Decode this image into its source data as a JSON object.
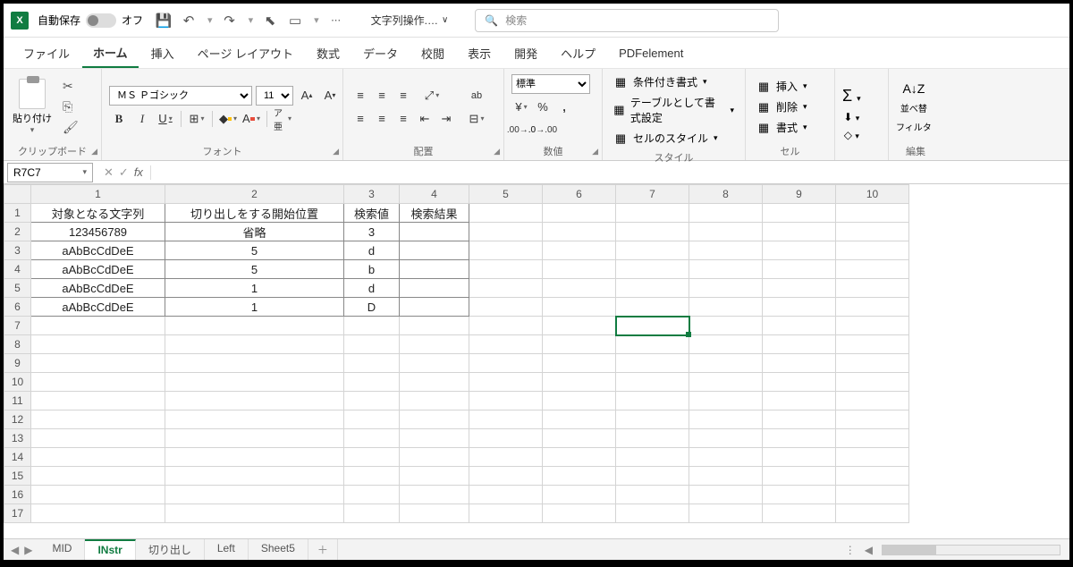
{
  "titlebar": {
    "autosave_label": "自動保存",
    "autosave_state": "オフ",
    "doc_title": "文字列操作.…",
    "search_placeholder": "検索"
  },
  "tabs": {
    "file": "ファイル",
    "home": "ホーム",
    "insert": "挿入",
    "page_layout": "ページ レイアウト",
    "formulas": "数式",
    "data": "データ",
    "review": "校閲",
    "view": "表示",
    "developer": "開発",
    "help": "ヘルプ",
    "pdfelement": "PDFelement"
  },
  "ribbon": {
    "clipboard": {
      "paste": "貼り付け",
      "label": "クリップボード"
    },
    "font": {
      "name": "ＭＳ Ｐゴシック",
      "size": "11",
      "label": "フォント",
      "phonetic": "ア亜"
    },
    "align": {
      "label": "配置",
      "wrap": "ab"
    },
    "number": {
      "format": "標準",
      "label": "数値"
    },
    "styles": {
      "cond": "条件付き書式",
      "table": "テーブルとして書式設定",
      "cell": "セルのスタイル",
      "label": "スタイル"
    },
    "cells": {
      "insert": "挿入",
      "delete": "削除",
      "format": "書式",
      "label": "セル"
    },
    "editing": {
      "sort": "並べ替",
      "filter": "フィルタ",
      "label": "編集"
    }
  },
  "namebox": "R7C7",
  "columns": [
    "1",
    "2",
    "3",
    "4",
    "5",
    "6",
    "7",
    "8",
    "9",
    "10"
  ],
  "rows_visible": 17,
  "data": {
    "header": [
      "対象となる文字列",
      "切り出しをする開始位置",
      "検索値",
      "検索結果"
    ],
    "rows": [
      [
        "123456789",
        "省略",
        "3",
        ""
      ],
      [
        "aAbBcCdDeE",
        "5",
        "d",
        ""
      ],
      [
        "aAbBcCdDeE",
        "5",
        "b",
        ""
      ],
      [
        "aAbBcCdDeE",
        "1",
        "d",
        ""
      ],
      [
        "aAbBcCdDeE",
        "1",
        "D",
        ""
      ]
    ]
  },
  "selection": {
    "row": 7,
    "col": 7
  },
  "sheets": {
    "items": [
      "MID",
      "INstr",
      "切り出し",
      "Left",
      "Sheet5"
    ],
    "active": "INstr"
  }
}
